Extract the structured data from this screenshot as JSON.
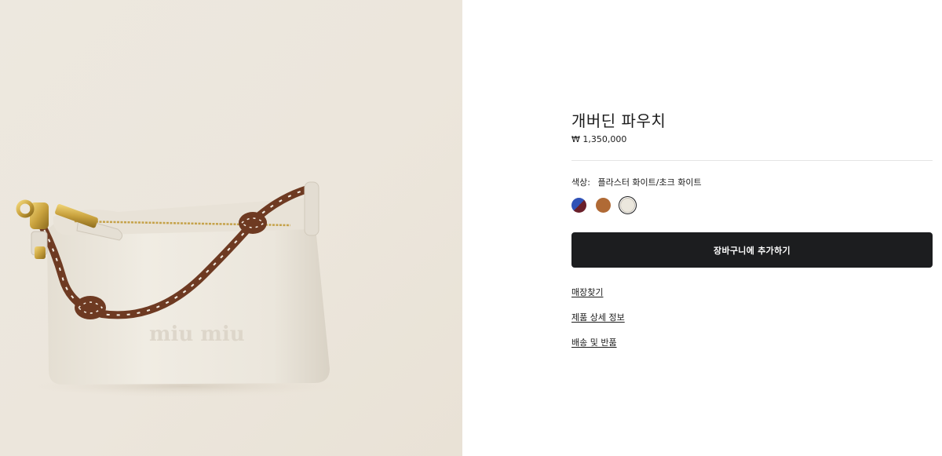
{
  "product": {
    "image_alt": "product-photo",
    "title": "개버딘 파우치",
    "price": "₩ 1,350,000"
  },
  "color": {
    "label": "색상:",
    "selected": "플라스터 화이트/초크 화이트",
    "swatches": [
      {
        "name": "blue-burgundy",
        "colors": [
          "#2f52b7",
          "#6a1f2a"
        ]
      },
      {
        "name": "cognac",
        "colors": [
          "#b06a35"
        ]
      },
      {
        "name": "plaster-white",
        "colors": [
          "#ebe7dd"
        ]
      }
    ]
  },
  "actions": {
    "add_to_cart": "장바구니에 추가하기"
  },
  "links": {
    "store_locator": "매장찾기",
    "product_details": "제품 상세 정보",
    "shipping_returns": "배송 및 반품"
  },
  "bag_logo": "miu miu"
}
